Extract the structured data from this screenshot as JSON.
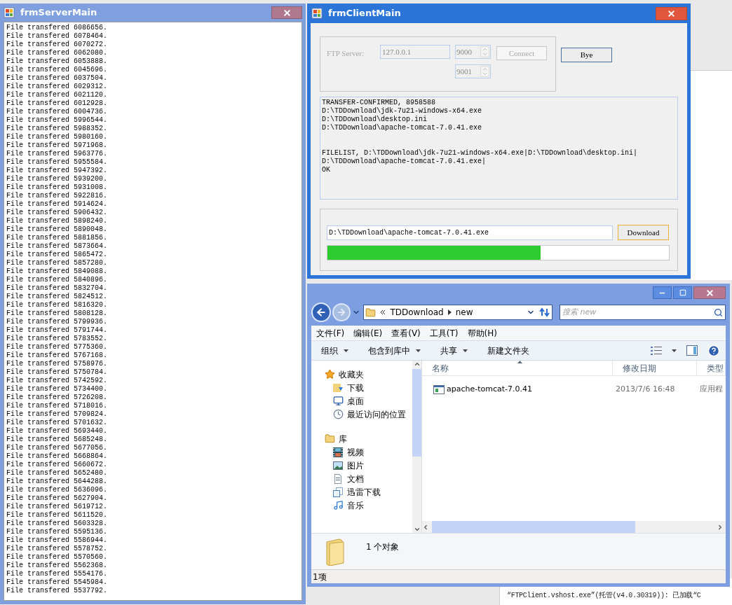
{
  "server_window": {
    "title": "frmServerMain",
    "active": false,
    "lines": [
      "File transfered 6086656.",
      "File transfered 6078464.",
      "File transfered 6070272.",
      "File transfered 6062080.",
      "File transfered 6053888.",
      "File transfered 6045696.",
      "File transfered 6037504.",
      "File transfered 6029312.",
      "File transfered 6021120.",
      "File transfered 6012928.",
      "File transfered 6004736.",
      "File transfered 5996544.",
      "File transfered 5988352.",
      "File transfered 5980160.",
      "File transfered 5971968.",
      "File transfered 5963776.",
      "File transfered 5955584.",
      "File transfered 5947392.",
      "File transfered 5939200.",
      "File transfered 5931008.",
      "File transfered 5922816.",
      "File transfered 5914624.",
      "File transfered 5906432.",
      "File transfered 5898240.",
      "File transfered 5890048.",
      "File transfered 5881856.",
      "File transfered 5873664.",
      "File transfered 5865472.",
      "File transfered 5857280.",
      "File transfered 5849088.",
      "File transfered 5840896.",
      "File transfered 5832704.",
      "File transfered 5824512.",
      "File transfered 5816320.",
      "File transfered 5808128.",
      "File transfered 5799936.",
      "File transfered 5791744.",
      "File transfered 5783552.",
      "File transfered 5775360.",
      "File transfered 5767168.",
      "File transfered 5758976.",
      "File transfered 5750784.",
      "File transfered 5742592.",
      "File transfered 5734400.",
      "File transfered 5726208.",
      "File transfered 5718016.",
      "File transfered 5709824.",
      "File transfered 5701632.",
      "File transfered 5693440.",
      "File transfered 5685248.",
      "File transfered 5677056.",
      "File transfered 5668864.",
      "File transfered 5660672.",
      "File transfered 5652480.",
      "File transfered 5644288.",
      "File transfered 5636096.",
      "File transfered 5627904.",
      "File transfered 5619712.",
      "File transfered 5611520.",
      "File transfered 5603328.",
      "File transfered 5595136.",
      "File transfered 5586944.",
      "File transfered 5578752.",
      "File transfered 5570560.",
      "File transfered 5562368.",
      "File transfered 5554176.",
      "File transfered 5545984.",
      "File transfered 5537792."
    ]
  },
  "client_window": {
    "title": "frmClientMain",
    "active": true,
    "server_label": "FTP Server:",
    "address": "127.0.0.1",
    "port_1": "9000",
    "port_2": "9001",
    "connect_button": {
      "label": "Connect",
      "disabled": true
    },
    "bye_button": {
      "label": "Bye",
      "disabled": false
    },
    "log_blocks": [
      [
        "TRANSFER-CONFIRMED, 8958588",
        "D:\\TDDownload\\jdk-7u21-windows-x64.exe",
        "D:\\TDDownload\\desktop.ini",
        "D:\\TDDownload\\apache-tomcat-7.0.41.exe"
      ],
      [
        "FILELIST, D:\\TDDownload\\jdk-7u21-windows-x64.exe|D:\\TDDownload\\desktop.ini|D:\\TDDownload\\apache-tomcat-7.0.41.exe|",
        "OK"
      ]
    ],
    "path": "D:\\TDDownload\\apache-tomcat-7.0.41.exe",
    "download_button": {
      "label": "Download",
      "focused": true
    },
    "progress": {
      "level": 0.625
    }
  },
  "explorer_window": {
    "active": false,
    "breadcrumb": [
      "TDDownload",
      "new"
    ],
    "search": {
      "placeholder": "搜索 new"
    },
    "menu": [
      "文件(F)",
      "编辑(E)",
      "查看(V)",
      "工具(T)",
      "帮助(H)"
    ],
    "toolbar": [
      {
        "label": "组织",
        "has_menu": true
      },
      {
        "label": "包含到库中",
        "has_menu": true
      },
      {
        "label": "共享",
        "has_menu": true
      },
      {
        "label": "新建文件夹",
        "has_menu": false
      }
    ],
    "nav": [
      {
        "label": "收藏夹",
        "kind": "favorites",
        "children": [
          {
            "label": "下载",
            "kind": "downloads"
          },
          {
            "label": "桌面",
            "kind": "desktop"
          },
          {
            "label": "最近访问的位置",
            "kind": "recent"
          }
        ]
      },
      {
        "label": "库",
        "kind": "library",
        "children": [
          {
            "label": "视频",
            "kind": "videos"
          },
          {
            "label": "图片",
            "kind": "pictures"
          },
          {
            "label": "文档",
            "kind": "documents"
          },
          {
            "label": "迅雷下载",
            "kind": "library_folder"
          },
          {
            "label": "音乐",
            "kind": "music"
          }
        ]
      }
    ],
    "columns": [
      {
        "label": "名称",
        "sorted": true
      },
      {
        "label": "修改日期",
        "sorted": false
      },
      {
        "label": "类型",
        "sorted": false
      }
    ],
    "rows": [
      {
        "name": "apache-tomcat-7.0.41",
        "modified": "2013/7/6 16:48",
        "type": "应用程"
      }
    ],
    "details": "1 个对象",
    "status": "1项"
  },
  "background_output": {
    "line": "“FTPClient.vshost.exe”(托管(v4.0.30319)): 已加载“C"
  }
}
